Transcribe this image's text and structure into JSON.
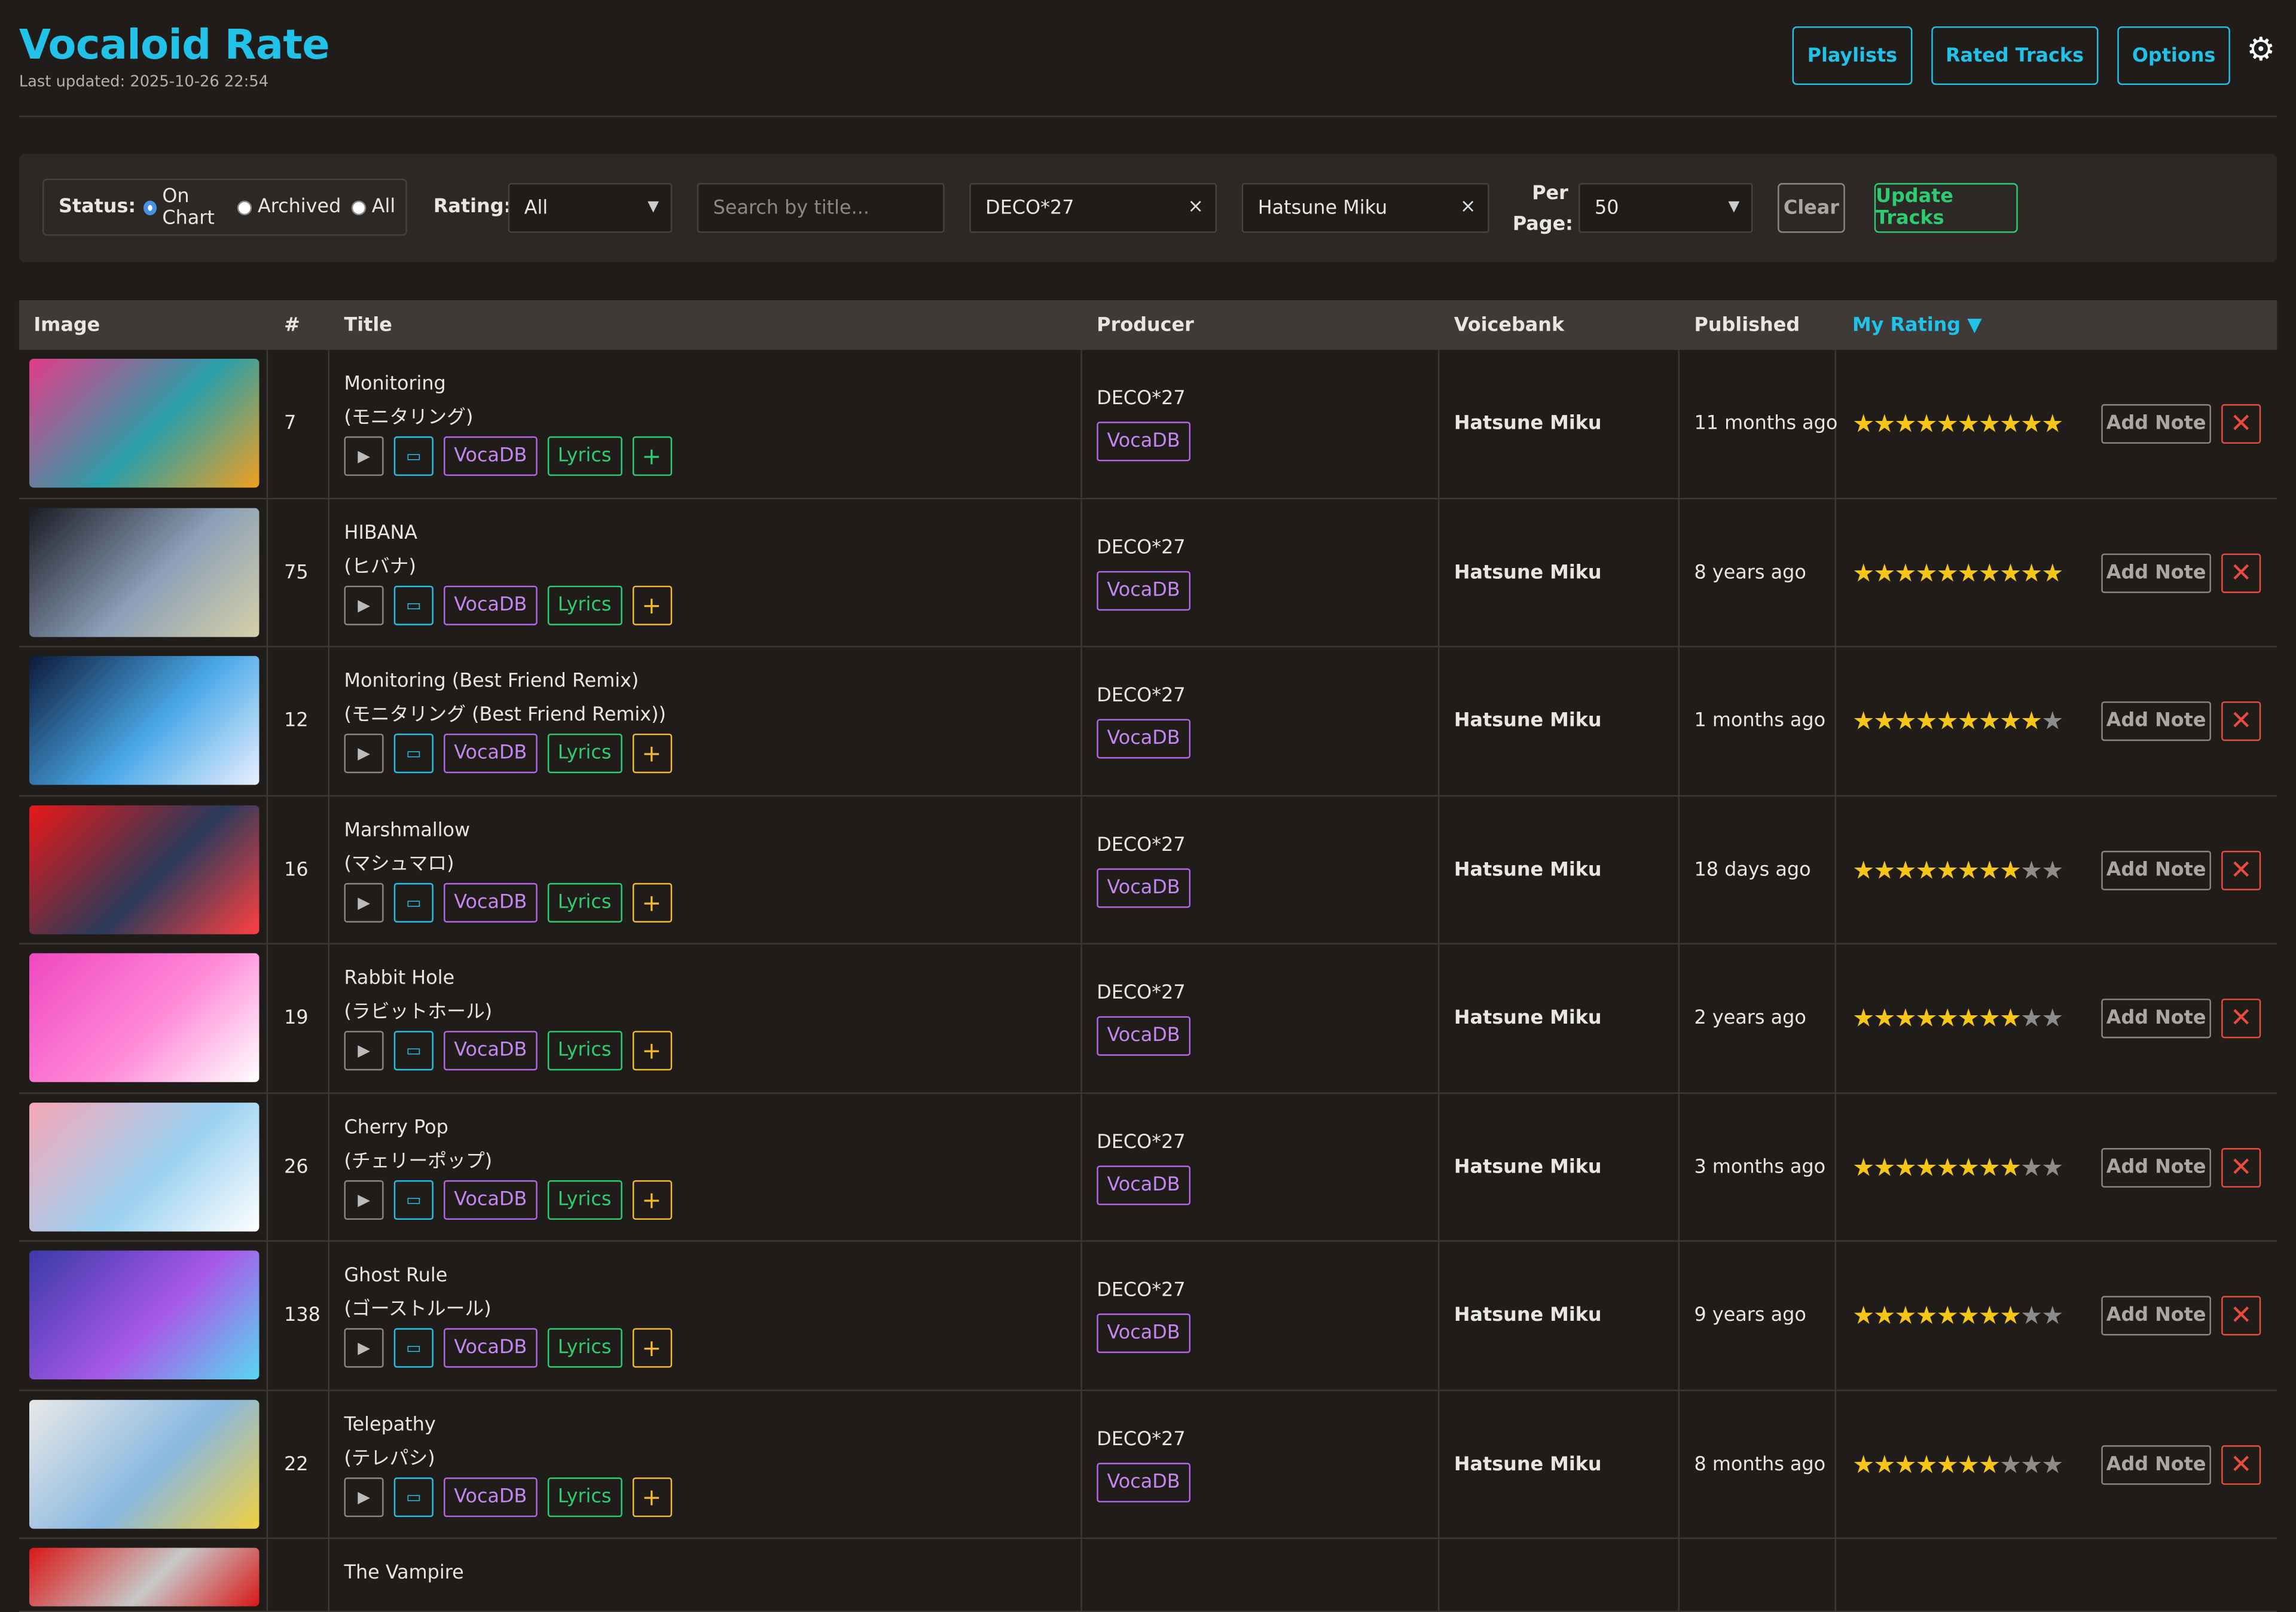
{
  "app": {
    "title": "Vocaloid Rate",
    "last_updated": "Last updated: 2025-10-26 22:54"
  },
  "nav": {
    "playlists": "Playlists",
    "rated_tracks": "Rated Tracks",
    "options": "Options",
    "settings_icon": "gear-icon"
  },
  "filters": {
    "status_label": "Status:",
    "status_options": [
      "On Chart",
      "Archived",
      "All"
    ],
    "status_selected": "On Chart",
    "rating_label": "Rating:",
    "rating_value": "All",
    "search_placeholder": "Search by title...",
    "producer_value": "DECO*27",
    "voicebank_value": "Hatsune Miku",
    "per_page_label_1": "Per",
    "per_page_label_2": "Page:",
    "per_page_value": "50",
    "clear_label": "Clear",
    "update_label": "Update Tracks"
  },
  "table": {
    "headers": {
      "image": "Image",
      "num": "#",
      "title": "Title",
      "producer": "Producer",
      "voicebank": "Voicebank",
      "published": "Published",
      "rating": "My Rating ▼"
    },
    "button_labels": {
      "vocadb": "VocaDB",
      "lyrics": "Lyrics",
      "add_note": "Add Note"
    },
    "rows": [
      {
        "num": "7",
        "title": "Monitoring",
        "title_jp": "(モニタリング)",
        "producer": "DECO*27",
        "voicebank": "Hatsune Miku",
        "published": "11 months ago",
        "rating": 10,
        "plus_color": "green",
        "thumb_colors": [
          "#e23c8a",
          "#2a9fa8",
          "#f0a020"
        ]
      },
      {
        "num": "75",
        "title": "HIBANA",
        "title_jp": "(ヒバナ)",
        "producer": "DECO*27",
        "voicebank": "Hatsune Miku",
        "published": "8 years ago",
        "rating": 10,
        "plus_color": "yellow",
        "thumb_colors": [
          "#1b1b24",
          "#8ca0b8",
          "#d6d0a8"
        ]
      },
      {
        "num": "12",
        "title": "Monitoring (Best Friend Remix)",
        "title_jp": "(モニタリング (Best Friend Remix))",
        "producer": "DECO*27",
        "voicebank": "Hatsune Miku",
        "published": "1 months ago",
        "rating": 9,
        "plus_color": "yellow",
        "thumb_colors": [
          "#0d1a3a",
          "#4aa8e8",
          "#e8f0ff"
        ]
      },
      {
        "num": "16",
        "title": "Marshmallow",
        "title_jp": "(マシュマロ)",
        "producer": "DECO*27",
        "voicebank": "Hatsune Miku",
        "published": "18 days ago",
        "rating": 8,
        "plus_color": "yellow",
        "thumb_colors": [
          "#e81818",
          "#2a3a5a",
          "#ff4040"
        ]
      },
      {
        "num": "19",
        "title": "Rabbit Hole",
        "title_jp": "(ラビットホール)",
        "producer": "DECO*27",
        "voicebank": "Hatsune Miku",
        "published": "2 years ago",
        "rating": 8,
        "plus_color": "yellow",
        "thumb_colors": [
          "#f048c0",
          "#ff8ad8",
          "#ffffff"
        ]
      },
      {
        "num": "26",
        "title": "Cherry Pop",
        "title_jp": "(チェリーポップ)",
        "producer": "DECO*27",
        "voicebank": "Hatsune Miku",
        "published": "3 months ago",
        "rating": 8,
        "plus_color": "yellow",
        "thumb_colors": [
          "#f8a8b8",
          "#9ad0f0",
          "#ffffff"
        ]
      },
      {
        "num": "138",
        "title": "Ghost Rule",
        "title_jp": "(ゴーストルール)",
        "producer": "DECO*27",
        "voicebank": "Hatsune Miku",
        "published": "9 years ago",
        "rating": 8,
        "plus_color": "yellow",
        "thumb_colors": [
          "#3a3aa8",
          "#a858e8",
          "#58d8f0"
        ]
      },
      {
        "num": "22",
        "title": "Telepathy",
        "title_jp": "(テレパシ)",
        "producer": "DECO*27",
        "voicebank": "Hatsune Miku",
        "published": "8 months ago",
        "rating": 7,
        "plus_color": "yellow",
        "thumb_colors": [
          "#e8e8e8",
          "#8ab8e0",
          "#f0d040"
        ]
      },
      {
        "num": "",
        "title": "The Vampire",
        "title_jp": "",
        "producer": "",
        "voicebank": "",
        "published": "",
        "rating": 0,
        "plus_color": "yellow",
        "thumb_colors": [
          "#d81818",
          "#c8c8c8",
          "#d81818"
        ],
        "partial": true
      }
    ]
  },
  "colors": {
    "accent": "#22c1e8",
    "green": "#2ecc71",
    "purple": "#b565e8",
    "star": "#f5c518",
    "danger": "#e74c3c"
  }
}
